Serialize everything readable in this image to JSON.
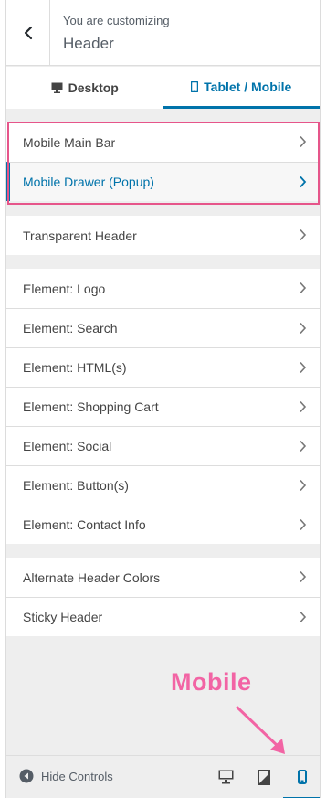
{
  "header": {
    "subtitle": "You are customizing",
    "title": "Header",
    "back_icon": "chevron-left-icon"
  },
  "tabs": [
    {
      "label": "Desktop",
      "icon": "desktop-icon",
      "active": false
    },
    {
      "label": "Tablet / Mobile",
      "icon": "mobile-icon",
      "active": true
    }
  ],
  "sections": [
    {
      "items": [
        {
          "label": "Mobile Main Bar",
          "active": false
        },
        {
          "label": "Mobile Drawer (Popup)",
          "active": true
        }
      ]
    },
    {
      "items": [
        {
          "label": "Transparent Header",
          "active": false
        }
      ]
    },
    {
      "items": [
        {
          "label": "Element: Logo",
          "active": false
        },
        {
          "label": "Element: Search",
          "active": false
        },
        {
          "label": "Element: HTML(s)",
          "active": false
        },
        {
          "label": "Element: Shopping Cart",
          "active": false
        },
        {
          "label": "Element: Social",
          "active": false
        },
        {
          "label": "Element: Button(s)",
          "active": false
        },
        {
          "label": "Element: Contact Info",
          "active": false
        }
      ]
    },
    {
      "items": [
        {
          "label": "Alternate Header Colors",
          "active": false
        },
        {
          "label": "Sticky Header",
          "active": false
        }
      ]
    }
  ],
  "annotation": {
    "label": "Mobile",
    "color": "#f264a4"
  },
  "footer": {
    "hide_controls_label": "Hide Controls",
    "devices": [
      {
        "icon": "desktop-icon",
        "active": false
      },
      {
        "icon": "tablet-icon",
        "active": false
      },
      {
        "icon": "mobile-icon",
        "active": true
      }
    ]
  },
  "colors": {
    "accent": "#0073aa",
    "highlight": "#e6558a"
  }
}
